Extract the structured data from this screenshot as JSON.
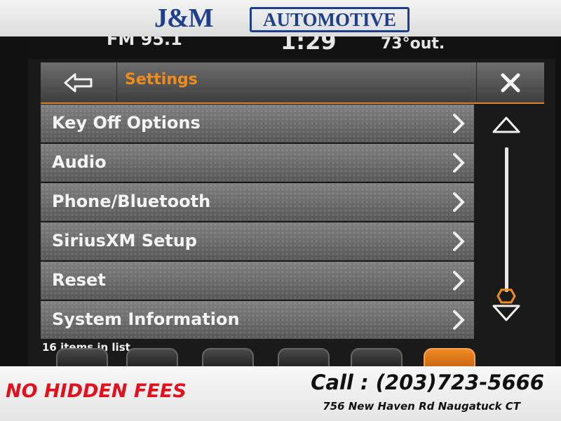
{
  "dealer": {
    "logo_jm": "J&M",
    "logo_automotive": "AUTOMOTIVE",
    "slogan": "NO HIDDEN FEES",
    "phone": "Call : (203)723-5666",
    "address": "756 New Haven Rd Naugatuck CT"
  },
  "status": {
    "radio": "FM 95.1",
    "time": "1:29",
    "temperature": "73°out."
  },
  "header": {
    "title": "Settings",
    "back_icon": "back-arrow-icon",
    "close_icon": "close-icon"
  },
  "menu": {
    "items": [
      {
        "label": "Key Off Options"
      },
      {
        "label": "Audio"
      },
      {
        "label": "Phone/Bluetooth"
      },
      {
        "label": "SiriusXM Setup"
      },
      {
        "label": "Reset"
      },
      {
        "label": "System Information"
      }
    ],
    "count_text": "16 items in list"
  },
  "colors": {
    "accent": "#f08c1e",
    "dealer_blue": "#1f3f8c",
    "slogan_red": "#e3101e"
  }
}
